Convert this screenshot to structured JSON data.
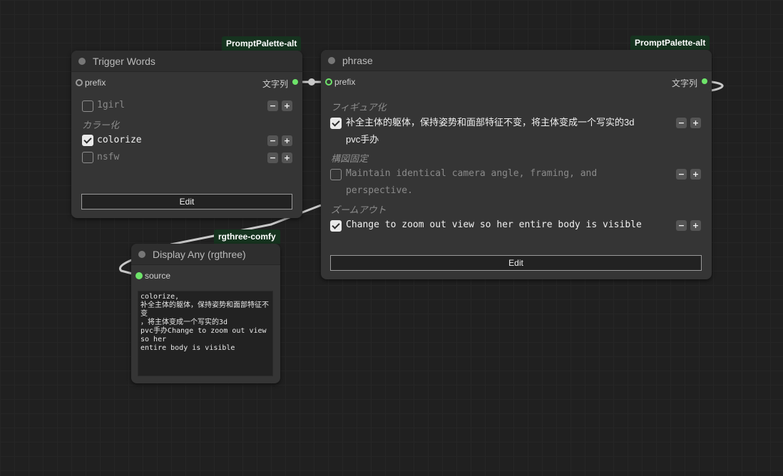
{
  "nodes": {
    "trigger_words": {
      "badge": "PromptPalette-alt",
      "title": "Trigger Words",
      "input_label": "prefix",
      "output_label": "文字列",
      "items": [
        {
          "text": "1girl",
          "checked": false
        },
        {
          "category": "カラー化"
        },
        {
          "text": "colorize",
          "checked": true
        },
        {
          "text": "nsfw",
          "checked": false
        }
      ],
      "edit_label": "Edit"
    },
    "phrase": {
      "badge": "PromptPalette-alt",
      "title": "phrase",
      "input_label": "prefix",
      "output_label": "文字列",
      "categories": [
        "フィギュア化",
        "構図固定",
        "ズームアウト"
      ],
      "items": [
        {
          "line1": "补全主体的躯体，保持姿势和面部特征不变，将主体变成一个写实的3d",
          "line2": "pvc手办",
          "checked": true
        },
        {
          "line1": "Maintain identical camera angle, framing, and",
          "line2": "perspective.",
          "checked": false
        },
        {
          "line1": "Change to zoom out view so her entire body is visible",
          "checked": true
        }
      ],
      "edit_label": "Edit"
    },
    "display_any": {
      "badge": "rgthree-comfy",
      "title": "Display Any (rgthree)",
      "input_label": "source",
      "output_text": "colorize,\n补全主体的躯体，保持姿势和面部特征不变\n，将主体变成一个写实的3d\npvc手办Change to zoom out view so her\nentire body is visible"
    }
  },
  "stepper": {
    "minus": "−",
    "plus": "+"
  },
  "colors": {
    "canvas_bg": "#202020",
    "node_bg": "#353535",
    "badge_bg": "#16331f",
    "slot_green": "#6ee46a",
    "link": "#c8c8c8"
  }
}
